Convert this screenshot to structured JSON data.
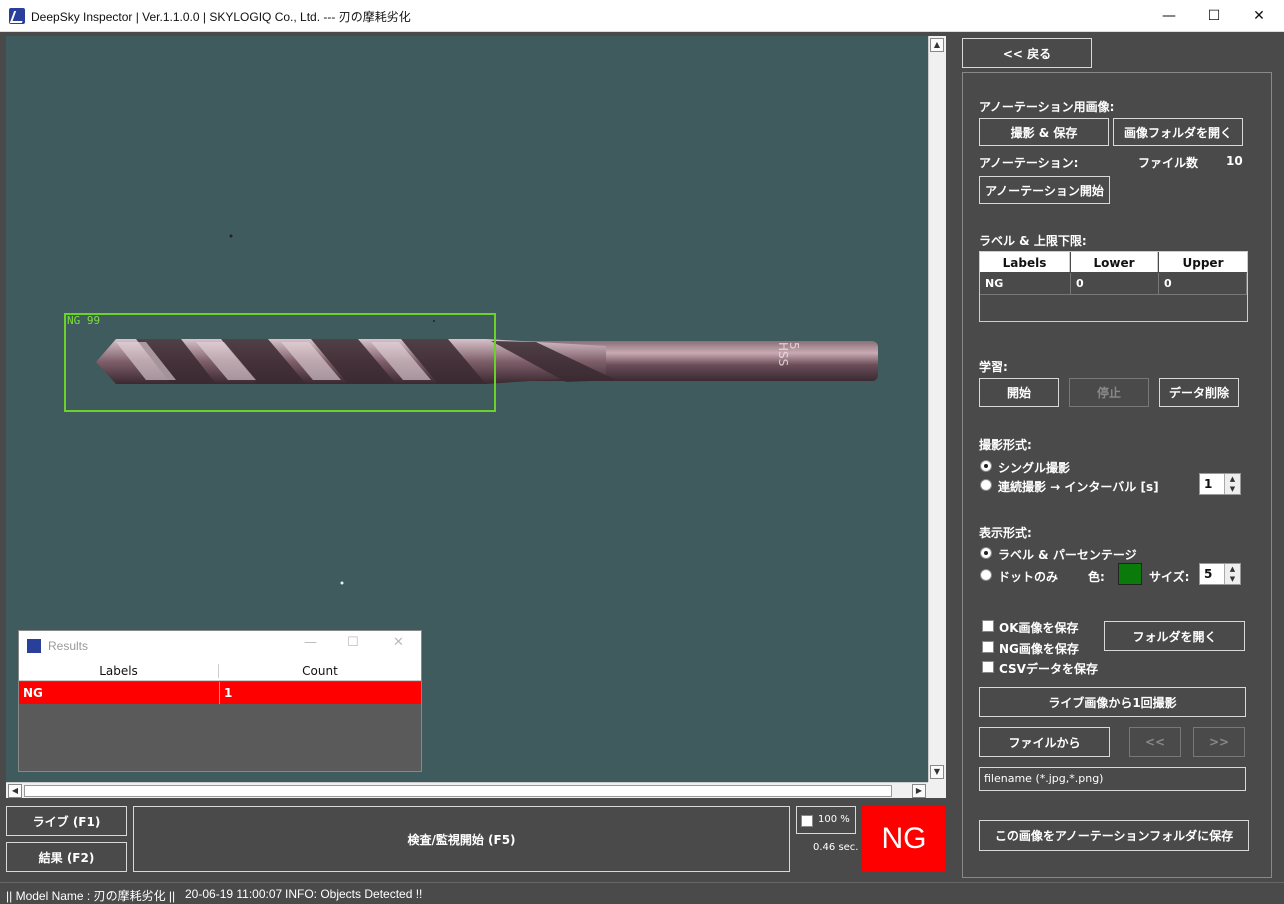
{
  "window": {
    "title": "DeepSky Inspector | Ver.1.1.0.0 | SKYLOGIQ Co., Ltd. --- 刃の摩耗劣化",
    "minimize": "—",
    "maximize": "☐",
    "close": "✕"
  },
  "viewer": {
    "detection_label": "NG 99",
    "shank_marking": "5 HSS"
  },
  "results_window": {
    "title": "Results",
    "columns": [
      "Labels",
      "Count"
    ],
    "rows": [
      {
        "label": "NG",
        "count": "1"
      }
    ]
  },
  "bottom": {
    "live_button": "ライブ (F1)",
    "results_button": "結果 (F2)",
    "inspect_button": "検査/監視開始 (F5)",
    "zoom_value": "100 %",
    "elapsed": "0.46 sec.",
    "verdict": "NG"
  },
  "side": {
    "back_button": "<< 戻る",
    "annotation_images_heading": "アノーテーション用画像:",
    "capture_save_button": "撮影 & 保存",
    "open_image_folder_button": "画像フォルダを開く",
    "annotation_heading": "アノーテーション:",
    "file_count_label": "ファイル数",
    "file_count_value": "10",
    "start_annotation_button": "アノーテーション開始",
    "label_limits_heading": "ラベル & 上限下限:",
    "label_table": {
      "columns": [
        "Labels",
        "Lower",
        "Upper"
      ],
      "rows": [
        {
          "label": "NG",
          "lower": "0",
          "upper": "0"
        }
      ]
    },
    "learning_heading": "学習:",
    "train_start_button": "開始",
    "train_stop_button": "停止",
    "delete_data_button": "データ削除",
    "capture_mode_heading": "撮影形式:",
    "single_capture_option": "シングル撮影",
    "continuous_capture_option": "連続撮影 → インターバル [s]",
    "interval_value": "1",
    "display_mode_heading": "表示形式:",
    "label_percent_option": "ラベル & パーセンテージ",
    "dot_only_option": "ドットのみ",
    "color_label": "色:",
    "dot_color": "#0a7a0a",
    "size_label": "サイズ:",
    "size_value": "5",
    "save_ok_label": "OK画像を保存",
    "save_ng_label": "NG画像を保存",
    "save_csv_label": "CSVデータを保存",
    "open_folder_button": "フォルダを開く",
    "capture_once_button": "ライブ画像から1回撮影",
    "from_file_button": "ファイルから",
    "prev_button": "<<",
    "next_button": ">>",
    "filename_placeholder": "filename (*.jpg,*.png)",
    "save_to_annotation_button": "この画像をアノーテーションフォルダに保存"
  },
  "status": {
    "model": "|| Model Name : 刃の摩耗劣化 ||",
    "timestamp": "20-06-19 11:00:07",
    "info": "INFO:   Objects Detected !!"
  }
}
